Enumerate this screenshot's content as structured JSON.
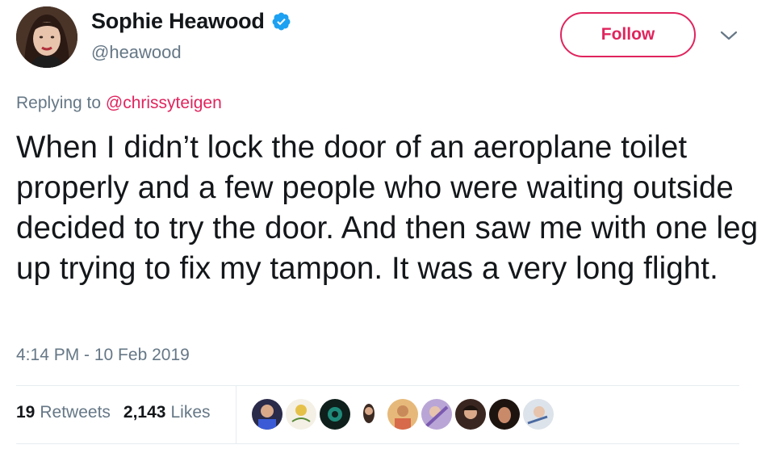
{
  "user": {
    "display_name": "Sophie Heawood",
    "handle": "@heawood",
    "verified": true
  },
  "follow_button": {
    "label": "Follow"
  },
  "reply": {
    "prefix": "Replying to",
    "mention": "@chrissyteigen"
  },
  "tweet": {
    "text": "When I didn’t lock the door of an aeroplane toilet properly and a few people who were waiting outside decided to try the door. And then saw me with one leg up trying to fix my tampon. It was a very long flight.",
    "timestamp": "4:14 PM - 10 Feb 2019"
  },
  "stats": {
    "retweets_count": "19",
    "retweets_label": "Retweets",
    "likes_count": "2,143",
    "likes_label": "Likes"
  },
  "colors": {
    "accent": "#e0245e",
    "verified": "#1da1f2",
    "secondary_text": "#657786",
    "primary_text": "#14171a",
    "divider": "#e6ecf0"
  },
  "icons": {
    "verified": "verified-badge-icon",
    "caret": "chevron-down-icon"
  }
}
